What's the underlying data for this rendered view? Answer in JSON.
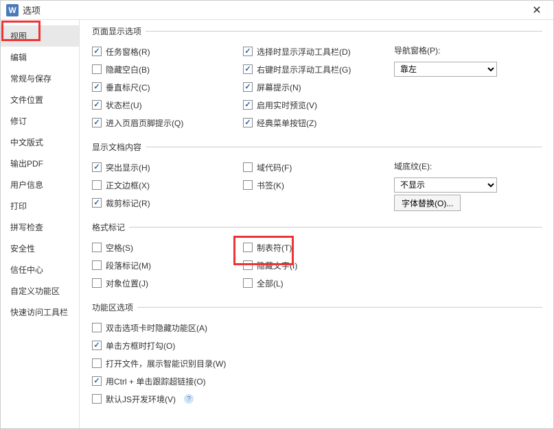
{
  "title": "选项",
  "close": "✕",
  "sidebar": {
    "items": [
      {
        "label": "视图",
        "selected": true
      },
      {
        "label": "编辑"
      },
      {
        "label": "常规与保存"
      },
      {
        "label": "文件位置"
      },
      {
        "label": "修订"
      },
      {
        "label": "中文版式"
      },
      {
        "label": "输出PDF"
      },
      {
        "label": "用户信息"
      },
      {
        "label": "打印"
      },
      {
        "label": "拼写检查"
      },
      {
        "label": "安全性"
      },
      {
        "label": "信任中心"
      },
      {
        "label": "自定义功能区"
      },
      {
        "label": "快速访问工具栏"
      }
    ]
  },
  "groups": {
    "page_display": {
      "legend": "页面显示选项",
      "items": {
        "task_pane": {
          "label": "任务窗格(R)",
          "checked": true
        },
        "sel_float": {
          "label": "选择时显示浮动工具栏(D)",
          "checked": true
        },
        "hide_blank": {
          "label": "隐藏空白(B)",
          "checked": false
        },
        "rclick_float": {
          "label": "右键时显示浮动工具栏(G)",
          "checked": true
        },
        "vruler": {
          "label": "垂直标尺(C)",
          "checked": true
        },
        "screen_tip": {
          "label": "屏幕提示(N)",
          "checked": true
        },
        "statusbar": {
          "label": "状态栏(U)",
          "checked": true
        },
        "live_preview": {
          "label": "启用实时预览(V)",
          "checked": true
        },
        "hf_tip": {
          "label": "进入页眉页脚提示(Q)",
          "checked": true
        },
        "classic_menu": {
          "label": "经典菜单按钮(Z)",
          "checked": true
        }
      },
      "nav_pane": {
        "label": "导航窗格(P):",
        "value": "靠左"
      }
    },
    "show_doc": {
      "legend": "显示文档内容",
      "items": {
        "highlight": {
          "label": "突出显示(H)",
          "checked": true
        },
        "field_code": {
          "label": "域代码(F)",
          "checked": false
        },
        "text_border": {
          "label": "正文边框(X)",
          "checked": false
        },
        "bookmark": {
          "label": "书签(K)",
          "checked": false
        },
        "crop_mark": {
          "label": "裁剪标记(R)",
          "checked": true
        }
      },
      "field_shade": {
        "label": "域底纹(E):",
        "value": "不显示"
      },
      "font_replace_btn": "字体替换(O)..."
    },
    "format_marks": {
      "legend": "格式标记",
      "items": {
        "space": {
          "label": "空格(S)",
          "checked": false
        },
        "tab": {
          "label": "制表符(T)",
          "checked": false
        },
        "para_mark": {
          "label": "段落标记(M)",
          "checked": false
        },
        "hidden": {
          "label": "隐藏文字(I)",
          "checked": false
        },
        "anchor": {
          "label": "对象位置(J)",
          "checked": false
        },
        "all": {
          "label": "全部(L)",
          "checked": false
        }
      }
    },
    "ribbon": {
      "legend": "功能区选项",
      "items": {
        "dbl_hide": {
          "label": "双击选项卡时隐藏功能区(A)",
          "checked": false
        },
        "click_tick": {
          "label": "单击方框时打勾(O)",
          "checked": true
        },
        "smart_dir": {
          "label": "打开文件，展示智能识别目录(W)",
          "checked": false
        },
        "ctrl_click": {
          "label": "用Ctrl + 单击跟踪超链接(O)",
          "checked": true
        },
        "js_env": {
          "label": "默认JS开发环境(V)",
          "checked": false
        }
      }
    }
  }
}
